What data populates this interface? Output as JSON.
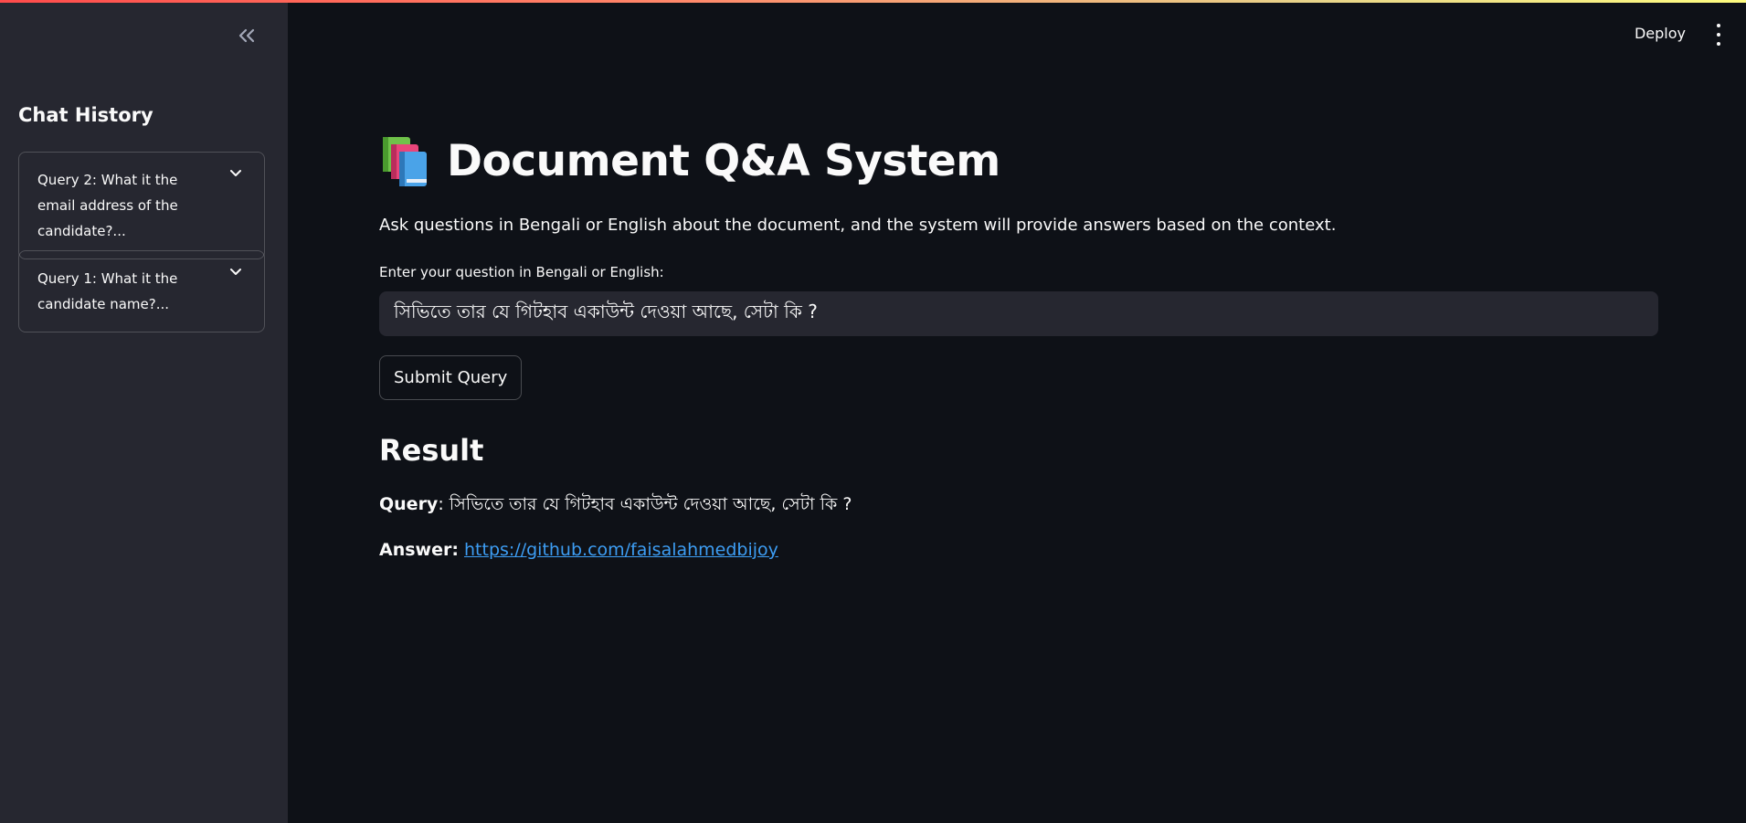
{
  "sidebar": {
    "title": "Chat History",
    "items": [
      {
        "label": "Query 2: What it the email address of the candidate?..."
      },
      {
        "label": "Query 1: What it the candidate name?..."
      }
    ]
  },
  "header": {
    "deploy_label": "Deploy"
  },
  "main": {
    "title": "Document Q&A System",
    "description": "Ask questions in Bengali or English about the document, and the system will provide answers based on the context.",
    "input_label": "Enter your question in Bengali or English:",
    "input_value": "সিভিতে তার যে গিটহাব একাউন্ট দেওয়া আছে, সেটা কি ?",
    "submit_label": "Submit Query",
    "result_heading": "Result",
    "query_label": "Query",
    "query_text": "সিভিতে তার যে গিটহাব একাউন্ট দেওয়া আছে, সেটা কি ?",
    "answer_label": "Answer:",
    "answer_link": "https://github.com/faisalahmedbijoy"
  },
  "colors": {
    "background": "#0e1117",
    "sidebar": "#262730",
    "link": "#3d9df3",
    "accent": "#ff4b4b"
  },
  "icons": {
    "collapse": "double-chevron-left-icon",
    "expander": "chevron-down-icon",
    "menu": "kebab-menu-icon",
    "title": "books-icon"
  }
}
